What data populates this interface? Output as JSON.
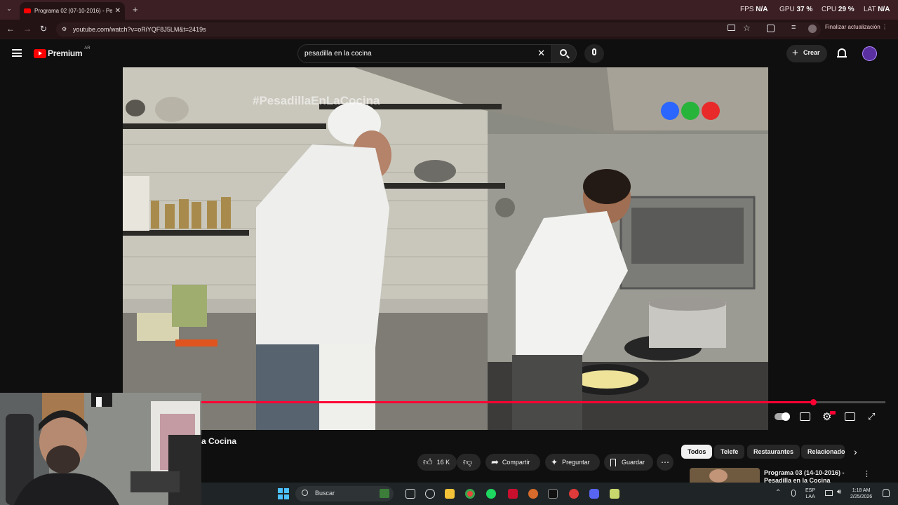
{
  "browser": {
    "tab_title": "Programa 02 (07-10-2016) - Pe",
    "url": "youtube.com/watch?v=oRiYQF8J5LM&t=2419s",
    "update_button": "Finalizar actualización",
    "stats": {
      "fps_label": "FPS",
      "fps_value": "N/A",
      "gpu_label": "GPU",
      "gpu_value": "37 %",
      "cpu_label": "CPU",
      "cpu_value": "29 %",
      "lat_label": "LAT",
      "lat_value": "N/A"
    }
  },
  "youtube": {
    "logo_text": "Premium",
    "logo_country": "AR",
    "search_value": "pesadilla en la cocina",
    "create_label": "Crear"
  },
  "video": {
    "overlay_hashtag": "#PesadillaEnLaCocina",
    "progress": 0.894,
    "title_fragment": "a Cocina"
  },
  "actions": {
    "likes": "16 K",
    "share": "Compartir",
    "ask": "Preguntar",
    "save": "Guardar"
  },
  "chips": [
    "Todos",
    "Telefe",
    "Restaurantes",
    "Relacionado"
  ],
  "recommendation": {
    "title_line1": "Programa 03 (14-10-2016) -",
    "title_line2": "Pesadilla en la Cocina"
  },
  "taskbar": {
    "search_placeholder": "Buscar",
    "lang_line1": "ESP",
    "lang_line2": "LAA",
    "time": "1:18 AM",
    "date": "2/25/2026"
  },
  "colors": {
    "chrome_bg": "#3b1f24",
    "youtube_red": "#ff0000",
    "progress_red": "#ff0033",
    "page_bg": "#0f0f0f"
  }
}
